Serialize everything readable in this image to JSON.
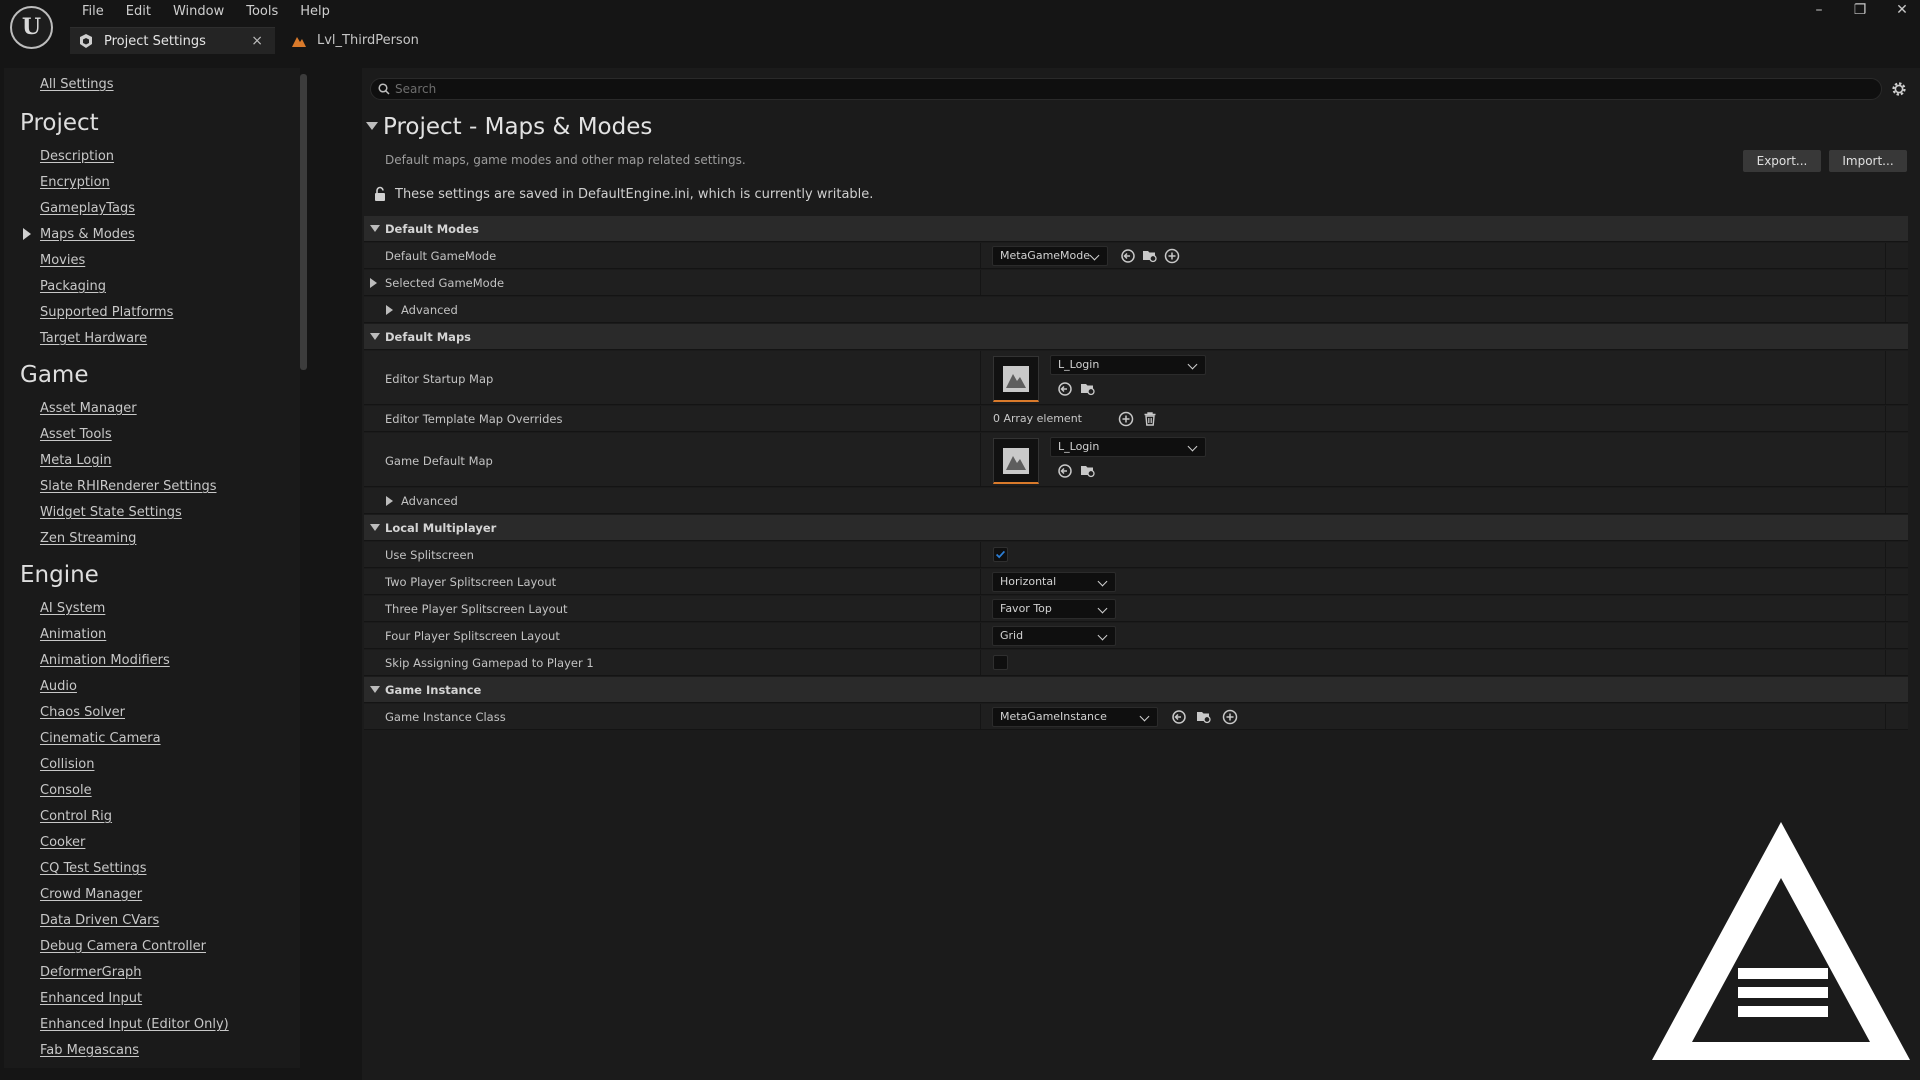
{
  "app": {
    "logo_letter": "U",
    "menu": [
      "File",
      "Edit",
      "Window",
      "Tools",
      "Help"
    ],
    "tabs": [
      {
        "label": "Project Settings",
        "active": true,
        "close": "×"
      },
      {
        "label": "Lvl_ThirdPerson",
        "active": false
      }
    ],
    "window_controls": {
      "minimize": "–",
      "restore": "❐",
      "close": "✕"
    }
  },
  "sidebar": {
    "all_settings": "All Settings",
    "categories": [
      {
        "title": "Project",
        "items": [
          "Description",
          "Encryption",
          "GameplayTags",
          "Maps & Modes",
          "Movies",
          "Packaging",
          "Supported Platforms",
          "Target Hardware"
        ]
      },
      {
        "title": "Game",
        "items": [
          "Asset Manager",
          "Asset Tools",
          "Meta Login",
          "Slate RHIRenderer Settings",
          "Widget State Settings",
          "Zen Streaming"
        ]
      },
      {
        "title": "Engine",
        "items": [
          "AI System",
          "Animation",
          "Animation Modifiers",
          "Audio",
          "Chaos Solver",
          "Cinematic Camera",
          "Collision",
          "Console",
          "Control Rig",
          "Cooker",
          "CQ Test Settings",
          "Crowd Manager",
          "Data Driven CVars",
          "Debug Camera Controller",
          "DeformerGraph",
          "Enhanced Input",
          "Enhanced Input (Editor Only)",
          "Fab Megascans"
        ]
      }
    ],
    "selected": "Maps & Modes"
  },
  "search": {
    "placeholder": "Search"
  },
  "page": {
    "title": "Project - Maps & Modes",
    "description": "Default maps, game modes and other map related settings.",
    "export_label": "Export...",
    "import_label": "Import...",
    "saved_note": "These settings are saved in DefaultEngine.ini, which is currently writable."
  },
  "sections": {
    "default_modes": {
      "title": "Default Modes",
      "default_gamemode": {
        "label": "Default GameMode",
        "value": "MetaGameMode"
      },
      "selected_gamemode": {
        "label": "Selected GameMode"
      },
      "advanced": "Advanced"
    },
    "default_maps": {
      "title": "Default Maps",
      "editor_startup_map": {
        "label": "Editor Startup Map",
        "value": "L_Login"
      },
      "editor_template_overrides": {
        "label": "Editor Template Map Overrides",
        "value": "0 Array element"
      },
      "game_default_map": {
        "label": "Game Default Map",
        "value": "L_Login"
      },
      "advanced": "Advanced"
    },
    "local_multiplayer": {
      "title": "Local Multiplayer",
      "use_splitscreen": {
        "label": "Use Splitscreen",
        "checked": true
      },
      "two_player": {
        "label": "Two Player Splitscreen Layout",
        "value": "Horizontal"
      },
      "three_player": {
        "label": "Three Player Splitscreen Layout",
        "value": "Favor Top"
      },
      "four_player": {
        "label": "Four Player Splitscreen Layout",
        "value": "Grid"
      },
      "skip_gamepad": {
        "label": "Skip Assigning Gamepad to Player 1",
        "checked": false
      }
    },
    "game_instance": {
      "title": "Game Instance",
      "game_instance_class": {
        "label": "Game Instance Class",
        "value": "MetaGameInstance"
      }
    }
  },
  "colors": {
    "accent_orange": "#d97a2b",
    "checkbox_blue": "#2d7fd6",
    "panel": "#1b1b1b"
  }
}
